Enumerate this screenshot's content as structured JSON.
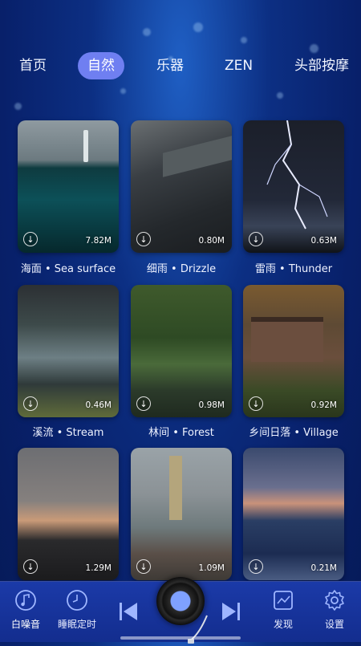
{
  "tabs": [
    {
      "label": "首页",
      "active": false
    },
    {
      "label": "自然",
      "active": true
    },
    {
      "label": "乐器",
      "active": false
    },
    {
      "label": "ZEN",
      "active": false
    },
    {
      "label": "头部按摩",
      "active": false
    }
  ],
  "sounds": [
    {
      "caption": "海面 • Sea surface",
      "size": "7.82M"
    },
    {
      "caption": "细雨 • Drizzle",
      "size": "0.80M"
    },
    {
      "caption": "雷雨 • Thunder",
      "size": "0.63M"
    },
    {
      "caption": "溪流 • Stream",
      "size": "0.46M"
    },
    {
      "caption": "林间 • Forest",
      "size": "0.98M"
    },
    {
      "caption": "乡间日落 • Village",
      "size": "0.92M"
    },
    {
      "caption": "",
      "size": "1.29M"
    },
    {
      "caption": "",
      "size": "1.09M"
    },
    {
      "caption": "",
      "size": "0.21M"
    }
  ],
  "bottom_nav": {
    "white_noise": "白噪音",
    "sleep_timer": "睡眠定时",
    "discover": "发现",
    "settings": "设置"
  },
  "colors": {
    "accent": "#6f7ff1",
    "background": "#0c2f83",
    "bottom_bar": "#1b3aa8"
  }
}
